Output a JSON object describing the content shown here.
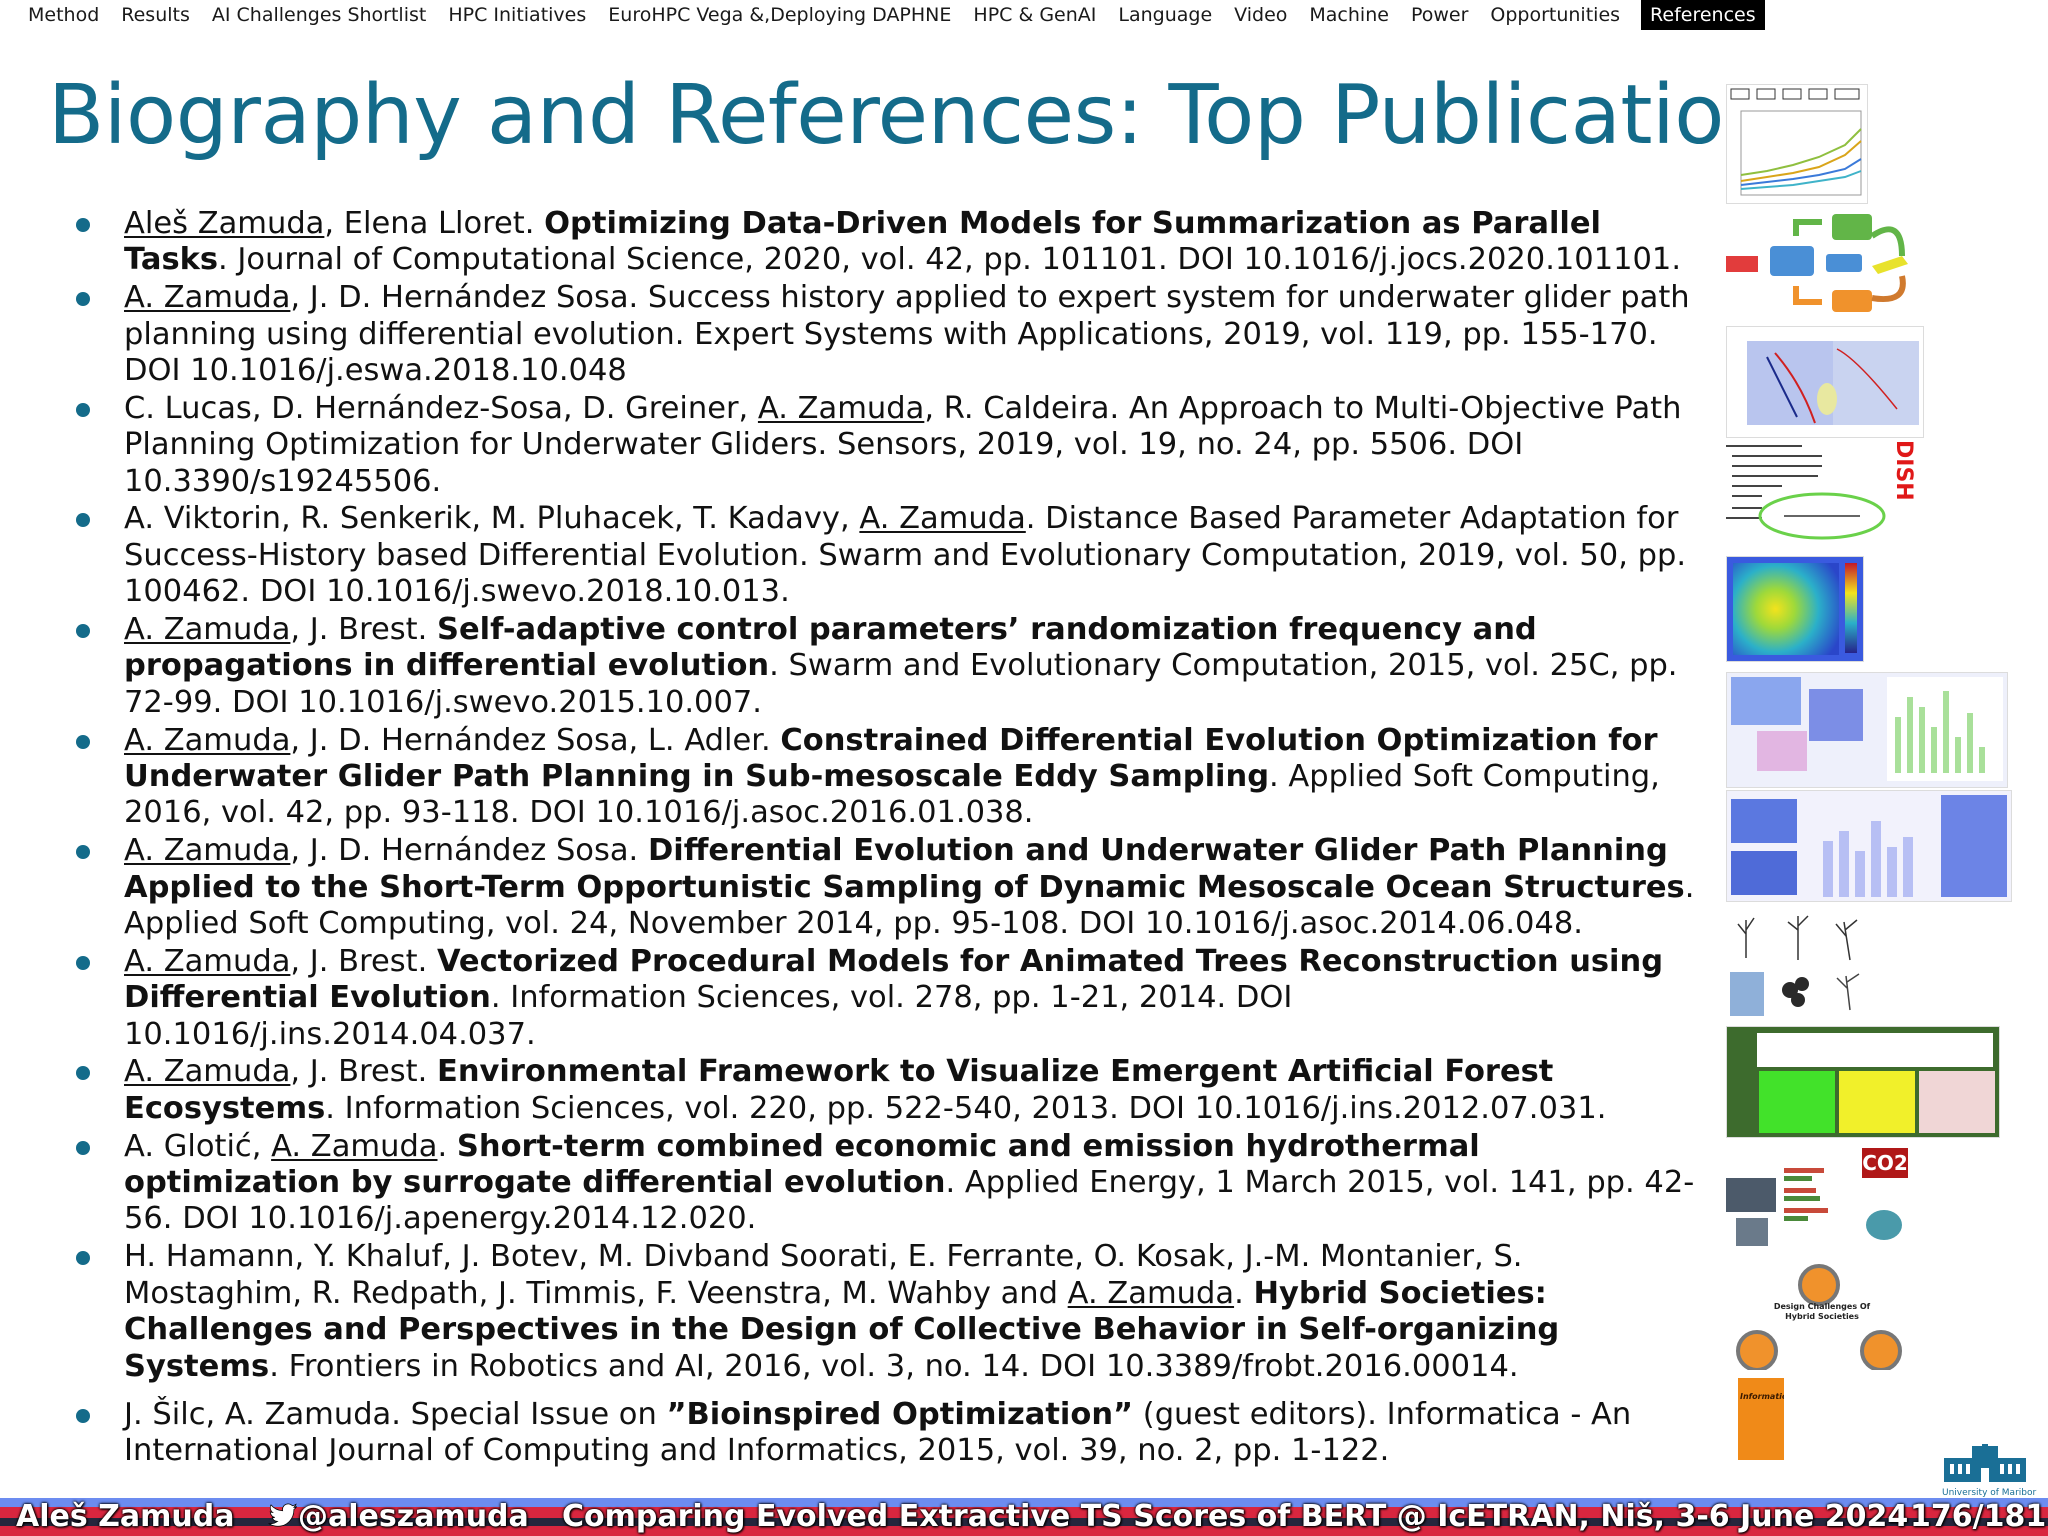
{
  "nav": {
    "items": [
      "Method",
      "Results",
      "AI Challenges Shortlist",
      "HPC Initiatives",
      "EuroHPC Vega &,Deploying DAPHNE",
      "HPC & GenAI",
      "Language",
      "Video",
      "Machine",
      "Power",
      "Opportunities"
    ],
    "active": "References"
  },
  "title": "Biography and References: Top Publications",
  "colors": {
    "accent": "#146b8a",
    "footer_blue": "#6c8cf0",
    "footer_red": "#d9263f",
    "footer_dark": "#25263d"
  },
  "publications": [
    {
      "pre": "",
      "author_u": "Aleš Zamuda",
      "authors_after": ", Elena Lloret. ",
      "title": "Optimizing Data-Driven Models for Summarization as Parallel Tasks",
      "rest": ". Journal of Computational Science, 2020, vol. 42, pp. 101101. DOI 10.1016/j.jocs.2020.101101."
    },
    {
      "pre": "",
      "author_u": "A. Zamuda",
      "authors_after": ", J. D. Hernández Sosa. Success history applied to expert system for underwater glider path planning using differential evolution. Expert Systems with Applications, 2019, vol. 119, pp. 155-170. DOI 10.1016/j.eswa.2018.10.048",
      "title": "",
      "rest": ""
    },
    {
      "pre": "C. Lucas, D. Hernández-Sosa, D. Greiner, ",
      "author_u": "A. Zamuda",
      "authors_after": ", R. Caldeira. An Approach to Multi-Objective Path Planning Optimization for Underwater Gliders. Sensors, 2019, vol. 19, no. 24, pp. 5506. DOI 10.3390/s19245506.",
      "title": "",
      "rest": ""
    },
    {
      "pre": "A. Viktorin, R. Senkerik, M. Pluhacek, T. Kadavy, ",
      "author_u": "A. Zamuda",
      "authors_after": ". Distance Based Parameter Adaptation for Success-History based Differential Evolution. Swarm and Evolutionary Computation, 2019, vol. 50, pp. 100462. DOI 10.1016/j.swevo.2018.10.013.",
      "title": "",
      "rest": ""
    },
    {
      "pre": "",
      "author_u": "A. Zamuda",
      "authors_after": ", J. Brest. ",
      "title": "Self-adaptive control parameters’ randomization frequency and propagations in differential evolution",
      "rest": ". Swarm and Evolutionary Computation, 2015, vol. 25C, pp. 72-99. DOI 10.1016/j.swevo.2015.10.007."
    },
    {
      "pre": "",
      "author_u": "A. Zamuda",
      "authors_after": ", J. D. Hernández Sosa, L. Adler. ",
      "title": "Constrained Differential Evolution Optimization for Underwater Glider Path Planning in Sub-mesoscale Eddy Sampling",
      "rest": ". Applied Soft Computing, 2016, vol. 42, pp. 93-118. DOI 10.1016/j.asoc.2016.01.038."
    },
    {
      "pre": "",
      "author_u": "A. Zamuda",
      "authors_after": ", J. D. Hernández Sosa. ",
      "title": "Differential Evolution and Underwater Glider Path Planning Applied to the Short-Term Opportunistic Sampling of Dynamic Mesoscale Ocean Structures",
      "rest": ". Applied Soft Computing, vol. 24, November 2014, pp. 95-108. DOI 10.1016/j.asoc.2014.06.048."
    },
    {
      "pre": "",
      "author_u": "A. Zamuda",
      "authors_after": ", J. Brest. ",
      "title": "Vectorized Procedural Models for Animated Trees Reconstruction using Differential Evolution",
      "rest": ". Information Sciences, vol. 278, pp. 1-21, 2014. DOI 10.1016/j.ins.2014.04.037."
    },
    {
      "pre": "",
      "author_u": "A. Zamuda",
      "authors_after": ", J. Brest. ",
      "title": "Environmental Framework to Visualize Emergent Artificial Forest Ecosystems",
      "rest": ". Information Sciences, vol. 220, pp. 522-540, 2013. DOI 10.1016/j.ins.2012.07.031."
    },
    {
      "pre": "A. Glotić, ",
      "author_u": "A. Zamuda",
      "authors_after": ". ",
      "title": "Short-term combined economic and emission hydrothermal optimization by surrogate differential evolution",
      "rest": ". Applied Energy, 1 March 2015, vol. 141, pp. 42-56. DOI 10.1016/j.apenergy.2014.12.020."
    },
    {
      "pre": "H. Hamann, Y. Khaluf, J. Botev, M. Divband Soorati, E. Ferrante, O. Kosak, J.-M. Montanier, S. Mostaghim, R. Redpath, J. Timmis, F. Veenstra, M. Wahby and ",
      "author_u": "A. Zamuda",
      "authors_after": ". ",
      "title": "Hybrid Societies: Challenges and Perspectives in the Design of Collective Behavior in Self-organizing Systems",
      "rest": ". Frontiers in Robotics and AI, 2016, vol. 3, no. 14. DOI 10.3389/frobt.2016.00014."
    },
    {
      "pre": "J. Šilc, A. Zamuda. Special Issue on ",
      "author_u": "",
      "authors_after": "",
      "title": "”Bioinspired Optimization”",
      "rest": " (guest editors). Informatica - An International Journal of Computing and Informatics, 2015, vol. 39, no. 2, pp. 1-122."
    }
  ],
  "thumbs": {
    "dish_label": "DISH",
    "co2_label": "CO2",
    "design_label": "Design Challenges Of Hybrid Societies",
    "informatica_label": "Informatica",
    "university_label": "University of Maribor"
  },
  "footer": {
    "author": "Aleš Zamuda",
    "twitter": "@aleszamuda",
    "talk": "Comparing Evolved Extractive TS Scores of BERT @ IcETRAN, Niš, 3-6 June 2024",
    "page": "176/181"
  }
}
